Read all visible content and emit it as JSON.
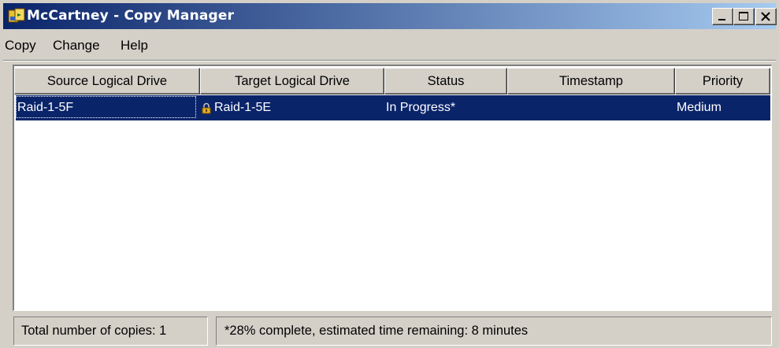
{
  "window": {
    "title": "McCartney - Copy Manager",
    "icon": "copy-manager-app-icon"
  },
  "caption_buttons": {
    "minimize": "minimize-icon",
    "maximize": "maximize-icon",
    "close": "close-icon"
  },
  "menu": [
    {
      "label": "Copy"
    },
    {
      "label": "Change"
    },
    {
      "label": "Help"
    }
  ],
  "table": {
    "columns": [
      "Source Logical Drive",
      "Target Logical Drive",
      "Status",
      "Timestamp",
      "Priority"
    ],
    "rows": [
      {
        "source": "Raid-1-5F",
        "target": "Raid-1-5E",
        "target_icon": "lock-icon",
        "status": "In Progress*",
        "timestamp": "",
        "priority": "Medium",
        "selected": true
      }
    ]
  },
  "status_bar": {
    "total": "Total number of copies: 1",
    "progress_note": "*28% complete, estimated time remaining: 8 minutes"
  },
  "colors": {
    "selection": "#0a246a",
    "title_gradient_start": "#0a246a",
    "title_gradient_end": "#a6caf0",
    "face": "#d4d0c8"
  }
}
